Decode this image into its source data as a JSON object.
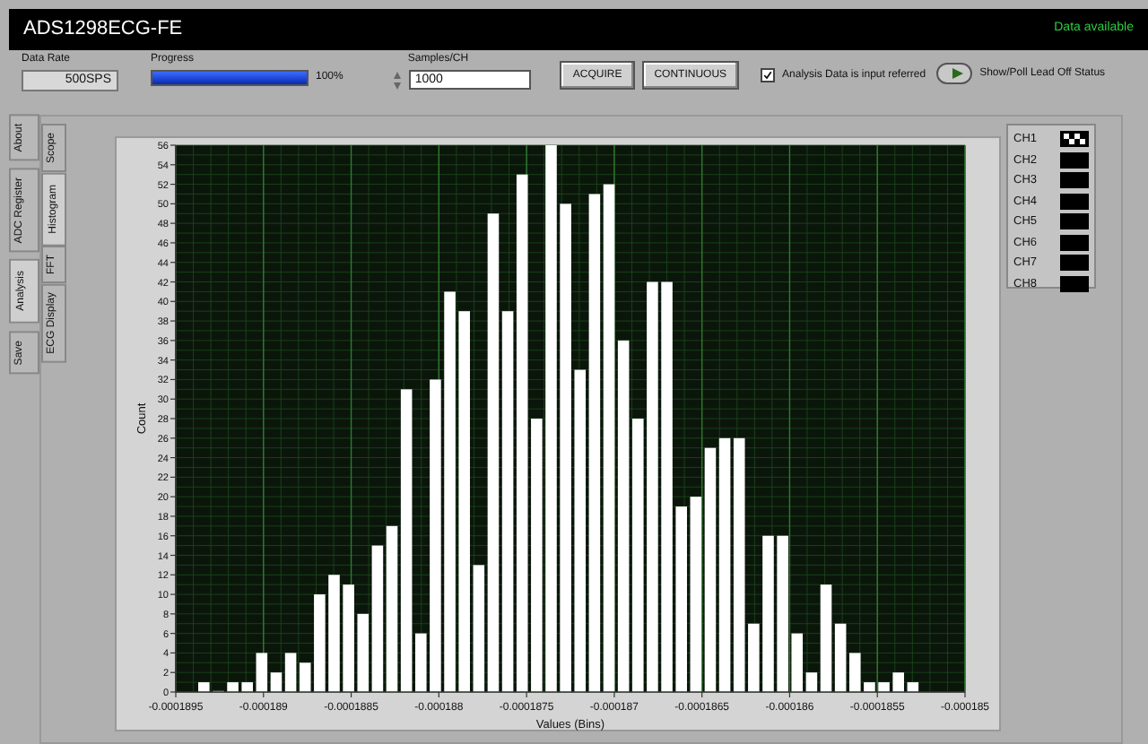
{
  "window": {
    "title": "ADS1298ECG-FE",
    "status": "Data available"
  },
  "controls": {
    "data_rate": {
      "label": "Data Rate",
      "value": "500SPS"
    },
    "progress": {
      "label": "Progress",
      "level": 1.0,
      "reading": "100%"
    },
    "samples": {
      "label": "Samples/CH",
      "value": "1000"
    },
    "buttons": [
      "ACQUIRE",
      "CONTINUOUS"
    ],
    "input_referred": {
      "label": "Analysis Data is input referred",
      "checked": true
    },
    "lead_off": {
      "label": "Show/Poll Lead Off Status"
    }
  },
  "main_tabs": [
    {
      "label": "About",
      "selected": false
    },
    {
      "label": "ADC Register",
      "selected": false
    },
    {
      "label": "Analysis",
      "selected": true
    },
    {
      "label": "Save",
      "selected": false
    }
  ],
  "analysis_tabs": [
    {
      "label": "Scope",
      "selected": false
    },
    {
      "label": "Histogram",
      "selected": true
    },
    {
      "label": "FFT",
      "selected": false
    },
    {
      "label": "ECG Display",
      "selected": false
    }
  ],
  "histogram": {
    "chart_data": {
      "type": "bar",
      "grid": true,
      "xlabel": "Values (Bins)",
      "ylabel": "Count",
      "x": [
        -0.00018934,
        -0.0001892575,
        -0.000189175,
        -0.0001890925,
        -0.00018901,
        -0.0001889275,
        -0.000188845,
        -0.0001887625,
        -0.00018868,
        -0.0001885975,
        -0.000188515,
        -0.0001884325,
        -0.00018835,
        -0.0001882675,
        -0.000188185,
        -0.0001881025,
        -0.00018802,
        -0.0001879375,
        -0.000187855,
        -0.0001877725,
        -0.00018769,
        -0.0001876075,
        -0.000187525,
        -0.0001874425,
        -0.00018736,
        -0.0001872775,
        -0.000187195,
        -0.0001871125,
        -0.00018703,
        -0.0001869475,
        -0.000186865,
        -0.0001867825,
        -0.0001867,
        -0.0001866175,
        -0.000186535,
        -0.0001864525,
        -0.00018637,
        -0.0001862875,
        -0.000186205,
        -0.0001861225,
        -0.00018604,
        -0.0001859575,
        -0.000185875,
        -0.0001857925,
        -0.00018571,
        -0.0001856275,
        -0.000185545,
        -0.0001854625,
        -0.00018538,
        -0.0001852975
      ],
      "values": [
        1,
        0,
        1,
        1,
        4,
        2,
        4,
        3,
        10,
        12,
        11,
        8,
        15,
        17,
        31,
        6,
        32,
        41,
        39,
        13,
        49,
        39,
        53,
        28,
        56,
        50,
        33,
        51,
        52,
        36,
        28,
        42,
        42,
        19,
        20,
        25,
        26,
        26,
        7,
        16,
        16,
        6,
        2,
        11,
        7,
        4,
        1,
        1,
        2,
        1
      ],
      "xlim": [
        -0.0001895,
        -0.000185
      ],
      "ylim": [
        0,
        56
      ],
      "xticks": [
        -0.0001895,
        -0.000189,
        -0.0001885,
        -0.000188,
        -0.0001875,
        -0.000187,
        -0.0001865,
        -0.000186,
        -0.0001855,
        -0.000185
      ],
      "yticks": [
        0,
        2,
        4,
        6,
        8,
        10,
        12,
        14,
        16,
        18,
        20,
        22,
        24,
        26,
        28,
        30,
        32,
        34,
        36,
        38,
        40,
        42,
        44,
        46,
        48,
        50,
        52,
        54,
        56
      ]
    }
  },
  "legend": [
    {
      "label": "CH1",
      "kind": "pattern"
    },
    {
      "label": "CH2",
      "kind": "plain"
    },
    {
      "label": "CH3",
      "kind": "plain"
    },
    {
      "label": "CH4",
      "kind": "plain"
    },
    {
      "label": "CH5",
      "kind": "plain"
    },
    {
      "label": "CH6",
      "kind": "plain"
    },
    {
      "label": "CH7",
      "kind": "plain"
    },
    {
      "label": "CH8",
      "kind": "plain"
    }
  ]
}
